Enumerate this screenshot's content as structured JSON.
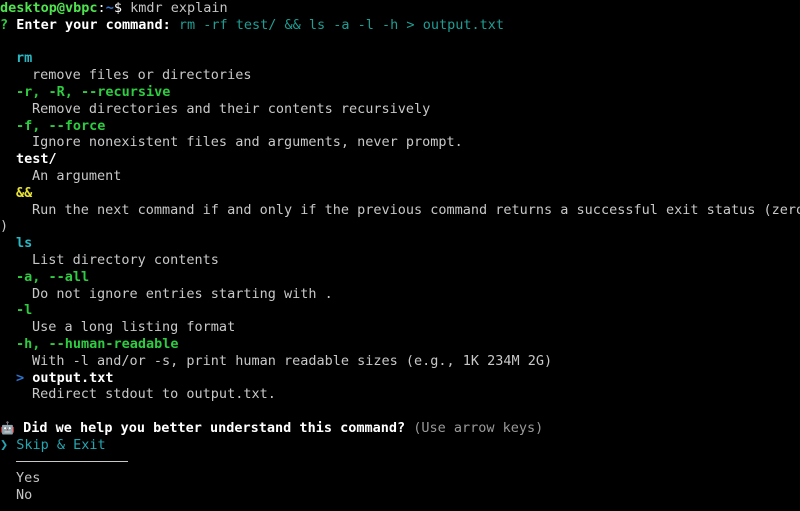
{
  "terminal": {
    "shell_prompt": {
      "user_host": "desktop@vbpc",
      "colon": ":",
      "path": "~",
      "sigil": "$",
      "typed_command": "kmdr explain"
    },
    "question_prompt": {
      "marker": "?",
      "label": "Enter your command:",
      "value": "rm -rf test/ && ls -a -l -h > output.txt"
    },
    "explanation": [
      {
        "token": "rm",
        "style": "program",
        "description": "remove files or directories"
      },
      {
        "token": "-r, -R, --recursive",
        "style": "option",
        "description": "Remove directories and their contents recursively"
      },
      {
        "token": "-f, --force",
        "style": "option",
        "description": "Ignore nonexistent files and arguments, never prompt."
      },
      {
        "token": "test/",
        "style": "argument",
        "description": "An argument"
      },
      {
        "token": "&&",
        "style": "operator",
        "description": "Run the next command if and only if the previous command returns a successful exit status (zero)"
      },
      {
        "token": "ls",
        "style": "program",
        "description": "List directory contents"
      },
      {
        "token": "-a, --all",
        "style": "option",
        "description": "Do not ignore entries starting with ."
      },
      {
        "token": "-l",
        "style": "option",
        "description": "Use a long listing format"
      },
      {
        "token": "-h, --human-readable",
        "style": "option",
        "description": "With -l and/or -s, print human readable sizes (e.g., 1K 234M 2G)"
      },
      {
        "token": "> output.txt",
        "style": "redirect",
        "redirect_symbol": ">",
        "redirect_target": "output.txt",
        "description": "Redirect stdout to output.txt."
      }
    ],
    "feedback_prompt": {
      "icon": "robot-icon",
      "icon_glyph": "🤖",
      "question": "Did we help you better understand this command?",
      "hint": "(Use arrow keys)",
      "pointer": "❯",
      "selected_option": "Skip & Exit",
      "options": [
        {
          "label": "Skip & Exit",
          "selected": true
        },
        {
          "label": "Yes",
          "selected": false
        },
        {
          "label": "No",
          "selected": false
        }
      ]
    },
    "wrapped_operator_overflow": ")"
  },
  "colors": {
    "background": "#000000",
    "program": "#29b9c4",
    "option": "#2ecc40",
    "argument": "#ffffff",
    "operator": "#e8e337",
    "redirect": "#2f74d0",
    "command_text": "#1f9e94",
    "description": "#c8c8c8",
    "prompt_user": "#4ee44e",
    "selected": "#23a7b3"
  }
}
